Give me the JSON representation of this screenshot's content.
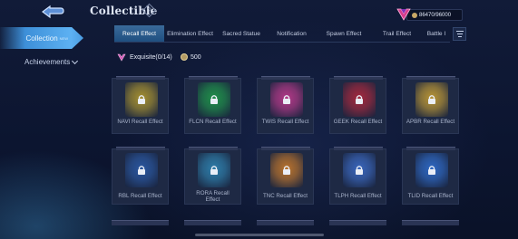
{
  "header": {
    "title": "Collectible",
    "info_icon": "info-diamond-icon"
  },
  "sidebar": {
    "items": [
      {
        "label": "Collection",
        "badge": "NEW",
        "active": true
      },
      {
        "label": "Achievements",
        "icon": "chevron-down-icon"
      }
    ]
  },
  "currency": {
    "icon": "diamond-gem-icon",
    "value": "86470/96000"
  },
  "tabs": [
    {
      "label": "Recall Effect",
      "active": true
    },
    {
      "label": "Elimination Effect"
    },
    {
      "label": "Sacred Statue"
    },
    {
      "label": "Notification"
    },
    {
      "label": "Spawn Effect"
    },
    {
      "label": "Trail Effect"
    },
    {
      "label": "Battle I"
    }
  ],
  "category": {
    "label": "Exquisite(0/14)",
    "fragments": "500"
  },
  "cards": [
    {
      "name": "NAVI Recall Effect",
      "color": "#b39a2e"
    },
    {
      "name": "FLCN Recall Effect",
      "color": "#1f9a4a"
    },
    {
      "name": "TWIS Recall Effect",
      "color": "#c23a8e"
    },
    {
      "name": "GEEK Recall Effect",
      "color": "#b0283c"
    },
    {
      "name": "APBR Recall Effect",
      "color": "#c9a034"
    },
    {
      "name": "RBL Recall Effect",
      "color": "#2a5aa8"
    },
    {
      "name": "RORA Recall Effect",
      "color": "#2f86b4"
    },
    {
      "name": "TNC Recall Effect",
      "color": "#c97a2a"
    },
    {
      "name": "TLPH Recall Effect",
      "color": "#3c6cc8"
    },
    {
      "name": "TLID Recall Effect",
      "color": "#2f6ed0"
    }
  ]
}
